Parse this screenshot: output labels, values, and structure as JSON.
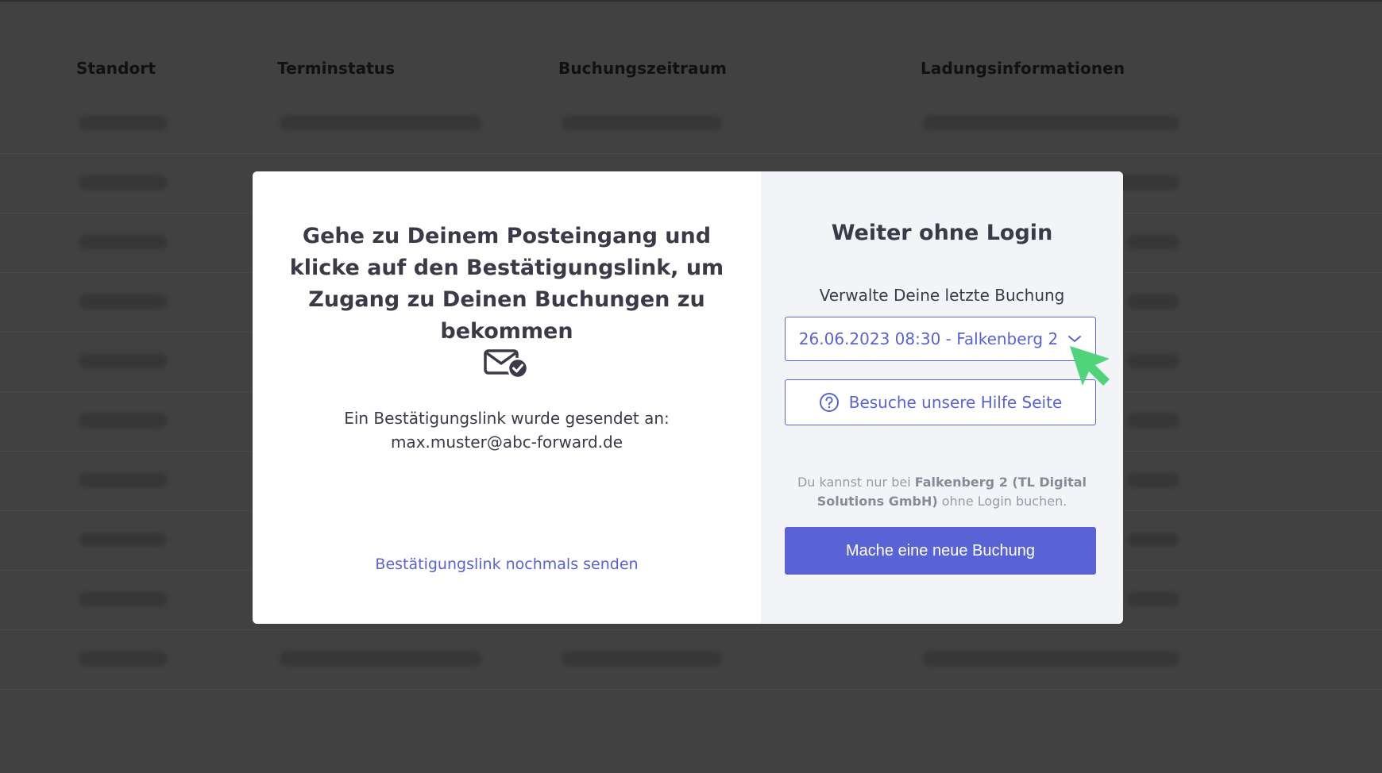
{
  "table": {
    "headers": [
      "Standort",
      "Terminstatus",
      "Buchungszeitraum",
      "Ladungsinformationen"
    ]
  },
  "modal": {
    "left": {
      "heading": "Gehe zu Deinem Posteingang und klicke auf den Bestätigungslink, um Zugang zu Deinen Buchungen zu bekommen",
      "sent_label": "Ein Bestätigungslink wurde gesendet an:",
      "email": "max.muster@abc-forward.de",
      "resend_link": "Bestätigungslink nochmals senden",
      "icon": "mail-check-icon"
    },
    "right": {
      "heading": "Weiter ohne Login",
      "manage_label": "Verwalte Deine letzte Buchung",
      "booking_select_value": "26.06.2023 08:30 - Falkenberg 2",
      "help_button": "Besuche unsere Hilfe Seite",
      "note_prefix": "Du kannst nur bei ",
      "note_bold": "Falkenberg 2 (TL Digital Solutions GmbH)",
      "note_suffix": " ohne Login buchen.",
      "new_booking_button": "Mache eine neue Buchung"
    }
  },
  "colors": {
    "accent": "#5963d6",
    "overlay": "#414141",
    "cursor": "#4fd37b"
  }
}
